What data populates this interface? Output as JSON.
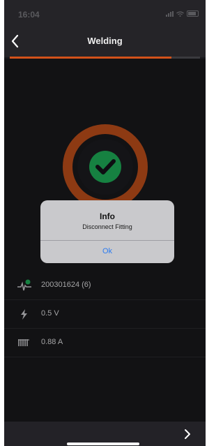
{
  "status_bar": {
    "time": "16:04"
  },
  "header": {
    "title": "Welding",
    "back_icon": "chevron-left-icon"
  },
  "progress": {
    "fraction": 0.85,
    "color": "#d2521a"
  },
  "status_indicator": {
    "icon": "check-icon",
    "ring_color": "#c4511b",
    "fill_color": "#1fb35a"
  },
  "dialog": {
    "title": "Info",
    "message": "Disconnect Fitting",
    "ok_label": "Ok"
  },
  "rows": [
    {
      "icon": "waveform-icon",
      "value": "200301624 (6)"
    },
    {
      "icon": "lightning-icon",
      "value": "0.5 V"
    },
    {
      "icon": "coil-icon",
      "value": "0.88 A"
    }
  ],
  "footer": {
    "next_icon": "chevron-right-icon"
  }
}
